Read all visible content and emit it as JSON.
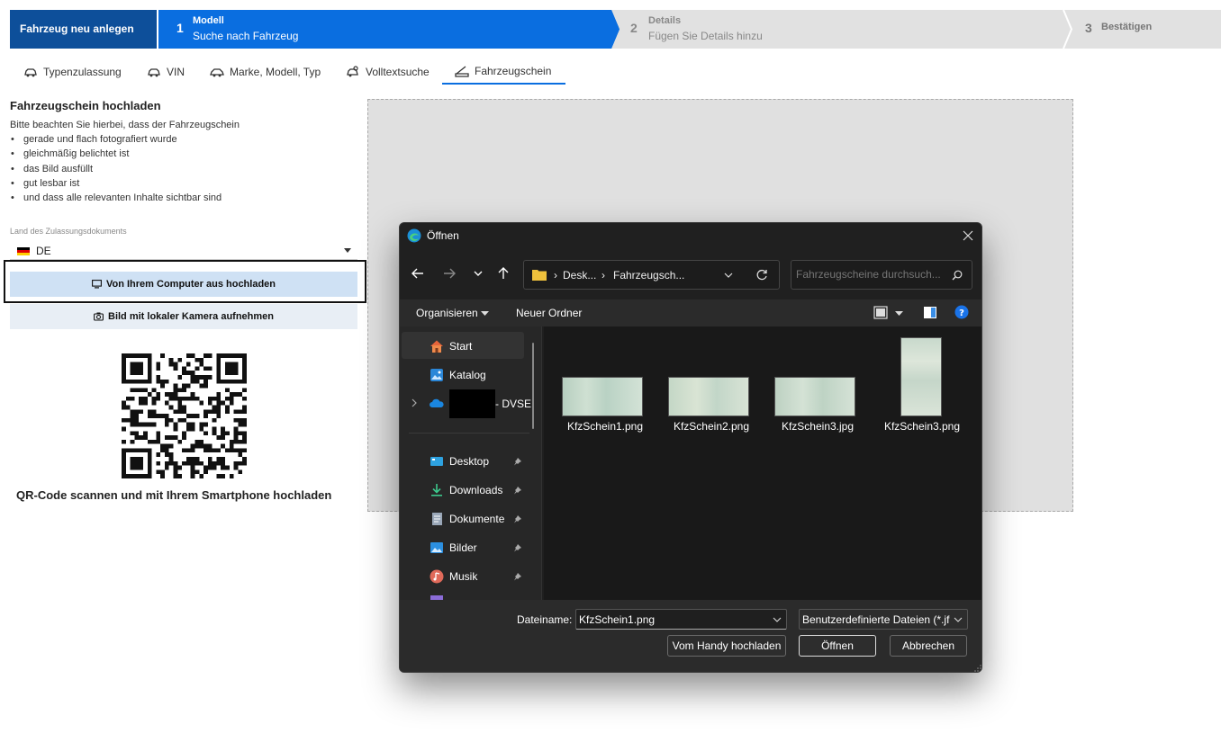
{
  "stepper": {
    "title": "Fahrzeug neu anlegen",
    "steps": [
      {
        "num": "1",
        "label": "Modell",
        "sub": "Suche nach Fahrzeug"
      },
      {
        "num": "2",
        "label": "Details",
        "sub": "Fügen Sie Details hinzu"
      },
      {
        "num": "3",
        "label": "Bestätigen",
        "sub": ""
      }
    ]
  },
  "tabs": [
    {
      "label": "Typenzulassung"
    },
    {
      "label": "VIN"
    },
    {
      "label": "Marke, Modell, Typ"
    },
    {
      "label": "Volltextsuche"
    },
    {
      "label": "Fahrzeugschein"
    }
  ],
  "upload": {
    "title": "Fahrzeugschein hochladen",
    "intro": "Bitte beachten Sie hierbei, dass der Fahrzeugschein",
    "hints": [
      "gerade und flach fotografiert wurde",
      "gleichmäßig belichtet ist",
      "das Bild ausfüllt",
      "gut lesbar ist",
      "und dass alle relevanten Inhalte sichtbar sind"
    ],
    "country_label": "Land des Zulassungsdokuments",
    "country_value": "DE",
    "btn_computer": "Von Ihrem Computer aus hochladen",
    "btn_camera": "Bild mit lokaler Kamera aufnehmen",
    "qr_caption": "QR-Code scannen und mit Ihrem Smartphone hochladen"
  },
  "dialog": {
    "title": "Öffnen",
    "breadcrumb": [
      "Desk...",
      "Fahrzeugsch..."
    ],
    "search_placeholder": "Fahrzeugscheine durchsuch...",
    "toolbar": {
      "organize": "Organisieren",
      "new_folder": "Neuer Ordner"
    },
    "sidebar": [
      {
        "label": "Start",
        "icon": "home-icon"
      },
      {
        "label": "Katalog",
        "icon": "gallery-icon"
      },
      {
        "label": "- DVSE",
        "icon": "onedrive-icon"
      },
      {
        "label": "Desktop",
        "icon": "desktop-icon"
      },
      {
        "label": "Downloads",
        "icon": "download-icon"
      },
      {
        "label": "Dokumente",
        "icon": "document-icon"
      },
      {
        "label": "Bilder",
        "icon": "pictures-icon"
      },
      {
        "label": "Musik",
        "icon": "music-icon"
      }
    ],
    "files": [
      {
        "name": "KfzSchein1.png"
      },
      {
        "name": "KfzSchein2.png"
      },
      {
        "name": "KfzSchein3.jpg"
      },
      {
        "name": "KfzSchein3.png"
      }
    ],
    "filename_label": "Dateiname:",
    "filename_value": "KfzSchein1.png",
    "filetype_value": "Benutzerdefinierte Dateien (*.jfi",
    "btn_handy": "Vom Handy hochladen",
    "btn_open": "Öffnen",
    "btn_cancel": "Abbrechen"
  },
  "colors": {
    "primary_blue": "#0a6ee0",
    "dark_blue": "#0d4f9a",
    "dialog_bg": "#202020"
  }
}
